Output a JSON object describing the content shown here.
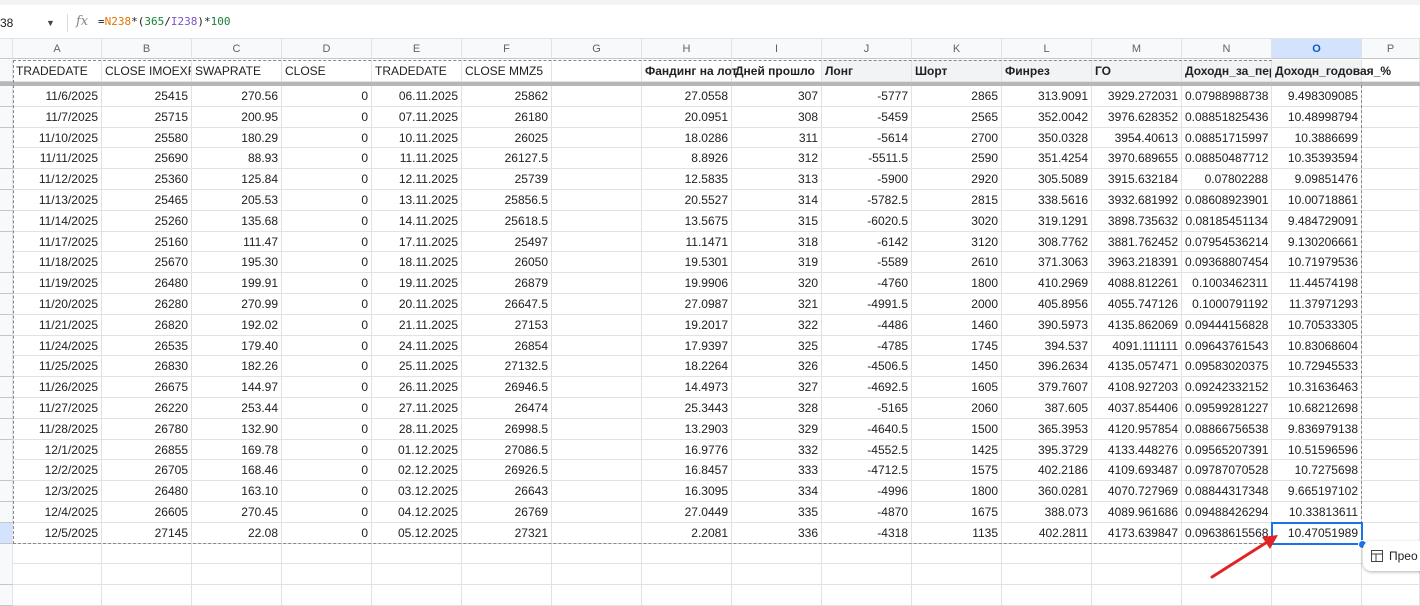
{
  "name_box": "38",
  "formula_bar": {
    "fx_label": "fx",
    "formula_parts": [
      {
        "t": "=",
        "c": "plain"
      },
      {
        "t": "N238",
        "c": "ref1"
      },
      {
        "t": "*(",
        "c": "plain"
      },
      {
        "t": "365",
        "c": "num"
      },
      {
        "t": "/",
        "c": "plain"
      },
      {
        "t": "I238",
        "c": "ref2"
      },
      {
        "t": ")*",
        "c": "plain"
      },
      {
        "t": "100",
        "c": "num"
      }
    ]
  },
  "columns": [
    "A",
    "B",
    "C",
    "D",
    "E",
    "F",
    "G",
    "H",
    "I",
    "J",
    "K",
    "L",
    "M",
    "N",
    "O",
    "P"
  ],
  "selected_column": "O",
  "header_row": {
    "A": "TRADEDATE",
    "B": "CLOSE IMOEXF",
    "C": "SWAPRATE",
    "D": "CLOSE",
    "E": "TRADEDATE",
    "F": "CLOSE MMZ5",
    "G": "",
    "H": "Фандинг на лот",
    "I": "Дней прошло",
    "J": "Лонг",
    "K": "Шорт",
    "L": "Финрез",
    "M": "ГО",
    "N": "Доходн_за_пер",
    "O": "Доходн_годовая_%"
  },
  "rows": [
    [
      "11/6/2025",
      "25415",
      "270.56",
      "0",
      "06.11.2025",
      "25862",
      "",
      "27.0558",
      "307",
      "-5777",
      "2865",
      "313.9091",
      "3929.272031",
      "0.07988988738",
      "9.498309085"
    ],
    [
      "11/7/2025",
      "25715",
      "200.95",
      "0",
      "07.11.2025",
      "26180",
      "",
      "20.0951",
      "308",
      "-5459",
      "2565",
      "352.0042",
      "3976.628352",
      "0.08851825436",
      "10.48998794"
    ],
    [
      "11/10/2025",
      "25580",
      "180.29",
      "0",
      "10.11.2025",
      "26025",
      "",
      "18.0286",
      "311",
      "-5614",
      "2700",
      "350.0328",
      "3954.40613",
      "0.08851715997",
      "10.3886699"
    ],
    [
      "11/11/2025",
      "25690",
      "88.93",
      "0",
      "11.11.2025",
      "26127.5",
      "",
      "8.8926",
      "312",
      "-5511.5",
      "2590",
      "351.4254",
      "3970.689655",
      "0.08850487712",
      "10.35393594"
    ],
    [
      "11/12/2025",
      "25360",
      "125.84",
      "0",
      "12.11.2025",
      "25739",
      "",
      "12.5835",
      "313",
      "-5900",
      "2920",
      "305.5089",
      "3915.632184",
      "0.07802288",
      "9.09851476"
    ],
    [
      "11/13/2025",
      "25465",
      "205.53",
      "0",
      "13.11.2025",
      "25856.5",
      "",
      "20.5527",
      "314",
      "-5782.5",
      "2815",
      "338.5616",
      "3932.681992",
      "0.08608923901",
      "10.00718861"
    ],
    [
      "11/14/2025",
      "25260",
      "135.68",
      "0",
      "14.11.2025",
      "25618.5",
      "",
      "13.5675",
      "315",
      "-6020.5",
      "3020",
      "319.1291",
      "3898.735632",
      "0.08185451134",
      "9.484729091"
    ],
    [
      "11/17/2025",
      "25160",
      "111.47",
      "0",
      "17.11.2025",
      "25497",
      "",
      "11.1471",
      "318",
      "-6142",
      "3120",
      "308.7762",
      "3881.762452",
      "0.07954536214",
      "9.130206661"
    ],
    [
      "11/18/2025",
      "25670",
      "195.30",
      "0",
      "18.11.2025",
      "26050",
      "",
      "19.5301",
      "319",
      "-5589",
      "2610",
      "371.3063",
      "3963.218391",
      "0.09368807454",
      "10.71979536"
    ],
    [
      "11/19/2025",
      "26480",
      "199.91",
      "0",
      "19.11.2025",
      "26879",
      "",
      "19.9906",
      "320",
      "-4760",
      "1800",
      "410.2969",
      "4088.812261",
      "0.1003462311",
      "11.44574198"
    ],
    [
      "11/20/2025",
      "26280",
      "270.99",
      "0",
      "20.11.2025",
      "26647.5",
      "",
      "27.0987",
      "321",
      "-4991.5",
      "2000",
      "405.8956",
      "4055.747126",
      "0.1000791192",
      "11.37971293"
    ],
    [
      "11/21/2025",
      "26820",
      "192.02",
      "0",
      "21.11.2025",
      "27153",
      "",
      "19.2017",
      "322",
      "-4486",
      "1460",
      "390.5973",
      "4135.862069",
      "0.09444156828",
      "10.70533305"
    ],
    [
      "11/24/2025",
      "26535",
      "179.40",
      "0",
      "24.11.2025",
      "26854",
      "",
      "17.9397",
      "325",
      "-4785",
      "1745",
      "394.537",
      "4091.111111",
      "0.09643761543",
      "10.83068604"
    ],
    [
      "11/25/2025",
      "26830",
      "182.26",
      "0",
      "25.11.2025",
      "27132.5",
      "",
      "18.2264",
      "326",
      "-4506.5",
      "1450",
      "396.2634",
      "4135.057471",
      "0.09583020375",
      "10.72945533"
    ],
    [
      "11/26/2025",
      "26675",
      "144.97",
      "0",
      "26.11.2025",
      "26946.5",
      "",
      "14.4973",
      "327",
      "-4692.5",
      "1605",
      "379.7607",
      "4108.927203",
      "0.09242332152",
      "10.31636463"
    ],
    [
      "11/27/2025",
      "26220",
      "253.44",
      "0",
      "27.11.2025",
      "26474",
      "",
      "25.3443",
      "328",
      "-5165",
      "2060",
      "387.605",
      "4037.854406",
      "0.09599281227",
      "10.68212698"
    ],
    [
      "11/28/2025",
      "26780",
      "132.90",
      "0",
      "28.11.2025",
      "26998.5",
      "",
      "13.2903",
      "329",
      "-4640.5",
      "1500",
      "365.3953",
      "4120.957854",
      "0.08866756538",
      "9.836979138"
    ],
    [
      "12/1/2025",
      "26855",
      "169.78",
      "0",
      "01.12.2025",
      "27086.5",
      "",
      "16.9776",
      "332",
      "-4552.5",
      "1425",
      "395.3729",
      "4133.448276",
      "0.09565207391",
      "10.51596596"
    ],
    [
      "12/2/2025",
      "26705",
      "168.46",
      "0",
      "02.12.2025",
      "26926.5",
      "",
      "16.8457",
      "333",
      "-4712.5",
      "1575",
      "402.2186",
      "4109.693487",
      "0.09787070528",
      "10.7275698"
    ],
    [
      "12/3/2025",
      "26480",
      "163.10",
      "0",
      "03.12.2025",
      "26643",
      "",
      "16.3095",
      "334",
      "-4996",
      "1800",
      "360.0281",
      "4070.727969",
      "0.08844317348",
      "9.665197102"
    ],
    [
      "12/4/2025",
      "26605",
      "270.45",
      "0",
      "04.12.2025",
      "26769",
      "",
      "27.0449",
      "335",
      "-4870",
      "1675",
      "388.073",
      "4089.961686",
      "0.09488426294",
      "10.33813611"
    ],
    [
      "12/5/2025",
      "27145",
      "22.08",
      "0",
      "05.12.2025",
      "27321",
      "",
      "2.2081",
      "336",
      "-4318",
      "1135",
      "402.2811",
      "4173.639847",
      "0.09638615568",
      "10.47051989"
    ]
  ],
  "chip_label": "Прео",
  "colors": {
    "selection": "#1a73e8",
    "selected_header": "#d3e3fd",
    "annotation_arrow": "#e02424"
  }
}
